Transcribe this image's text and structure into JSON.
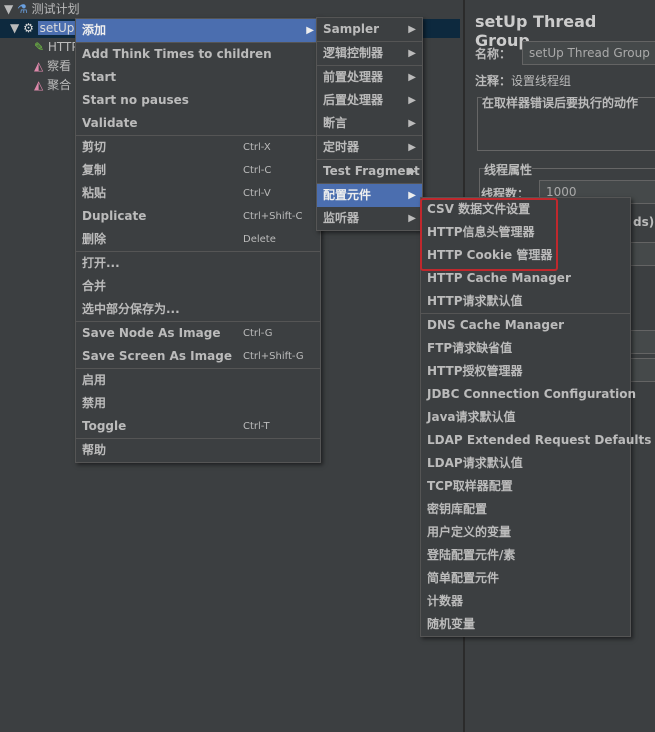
{
  "tree": {
    "items": [
      {
        "label": "测试计划",
        "icon": "flask-icon"
      },
      {
        "label": "setUp Thread Group",
        "icon": "gear-icon"
      },
      {
        "label": "HTTP",
        "icon": "pipette-icon"
      },
      {
        "label": "察看",
        "icon": "graph-icon"
      },
      {
        "label": "聚合",
        "icon": "graph-icon"
      }
    ]
  },
  "panel": {
    "title": "setUp Thread Group",
    "name_label": "名称：",
    "name_value": "setUp Thread Group",
    "comment_label": "注释：",
    "comment_value": "设置线程组",
    "error_action_label": "在取样器错误后要执行的动作",
    "thread_props_label": "线程属性",
    "threads_label": "线程数：",
    "threads_value": "1000",
    "rampup_fragment": "ds):"
  },
  "context_menu": {
    "items": [
      {
        "label": "添加",
        "arrow": true,
        "highlight": true
      },
      {
        "sep": true
      },
      {
        "label": "Add Think Times to children"
      },
      {
        "label": "Start"
      },
      {
        "label": "Start no pauses"
      },
      {
        "label": "Validate"
      },
      {
        "sep": true
      },
      {
        "label": "剪切",
        "shortcut": "Ctrl-X"
      },
      {
        "label": "复制",
        "shortcut": "Ctrl-C"
      },
      {
        "label": "粘贴",
        "shortcut": "Ctrl-V"
      },
      {
        "label": "Duplicate",
        "shortcut": "Ctrl+Shift-C"
      },
      {
        "label": "删除",
        "shortcut": "Delete"
      },
      {
        "sep": true
      },
      {
        "label": "打开..."
      },
      {
        "label": "合并"
      },
      {
        "label": "选中部分保存为..."
      },
      {
        "sep": true
      },
      {
        "label": "Save Node As Image",
        "shortcut": "Ctrl-G"
      },
      {
        "label": "Save Screen As Image",
        "shortcut": "Ctrl+Shift-G"
      },
      {
        "sep": true
      },
      {
        "label": "启用"
      },
      {
        "label": "禁用"
      },
      {
        "label": "Toggle",
        "shortcut": "Ctrl-T"
      },
      {
        "sep": true
      },
      {
        "label": "帮助"
      }
    ]
  },
  "add_menu": {
    "items": [
      {
        "label": "Sampler",
        "arrow": true
      },
      {
        "sep": true
      },
      {
        "label": "逻辑控制器",
        "arrow": true
      },
      {
        "sep": true
      },
      {
        "label": "前置处理器",
        "arrow": true
      },
      {
        "label": "后置处理器",
        "arrow": true
      },
      {
        "label": "断言",
        "arrow": true
      },
      {
        "sep": true
      },
      {
        "label": "定时器",
        "arrow": true
      },
      {
        "sep": true
      },
      {
        "label": "Test Fragment",
        "arrow": true
      },
      {
        "sep": true
      },
      {
        "label": "配置元件",
        "arrow": true,
        "highlight": true
      },
      {
        "label": "监听器",
        "arrow": true
      }
    ]
  },
  "config_menu": {
    "items": [
      {
        "label": "CSV 数据文件设置"
      },
      {
        "label": "HTTP信息头管理器"
      },
      {
        "label": "HTTP Cookie 管理器"
      },
      {
        "label": "HTTP Cache Manager"
      },
      {
        "label": "HTTP请求默认值"
      },
      {
        "sep": true
      },
      {
        "label": "DNS Cache Manager"
      },
      {
        "label": "FTP请求缺省值"
      },
      {
        "label": "HTTP授权管理器"
      },
      {
        "label": "JDBC Connection Configuration"
      },
      {
        "label": "Java请求默认值"
      },
      {
        "label": "LDAP Extended Request Defaults"
      },
      {
        "label": "LDAP请求默认值"
      },
      {
        "label": "TCP取样器配置"
      },
      {
        "label": "密钥库配置"
      },
      {
        "label": "用户定义的变量"
      },
      {
        "label": "登陆配置元件/素"
      },
      {
        "label": "简单配置元件"
      },
      {
        "label": "计数器"
      },
      {
        "label": "随机变量"
      }
    ]
  },
  "colors": {
    "highlight": "#4b6eaf",
    "annotation_box": "#c0282d"
  }
}
